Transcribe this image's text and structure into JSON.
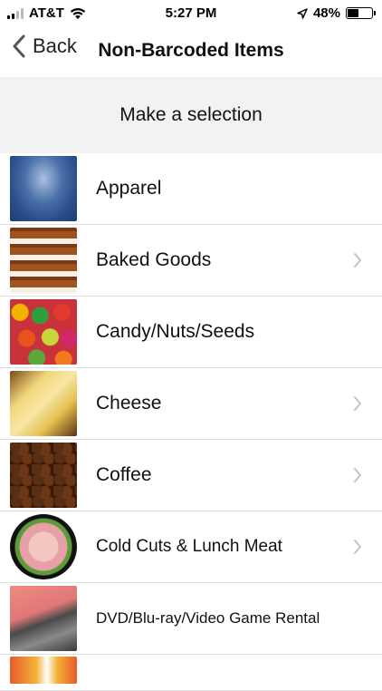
{
  "status_bar": {
    "carrier": "AT&T",
    "time": "5:27 PM",
    "battery_percent": "48%",
    "battery_level": 0.48,
    "icons": [
      "signal-icon",
      "wifi-icon",
      "location-arrow-icon",
      "battery-icon"
    ]
  },
  "nav": {
    "back_label": "Back",
    "title": "Non-Barcoded Items"
  },
  "section_header": "Make a selection",
  "items": [
    {
      "label": "Apparel",
      "has_chevron": false
    },
    {
      "label": "Baked Goods",
      "has_chevron": true
    },
    {
      "label": "Candy/Nuts/Seeds",
      "has_chevron": false
    },
    {
      "label": "Cheese",
      "has_chevron": true
    },
    {
      "label": "Coffee",
      "has_chevron": true
    },
    {
      "label": "Cold Cuts & Lunch Meat",
      "has_chevron": true
    },
    {
      "label": "DVD/Blu-ray/Video Game Rental",
      "has_chevron": false
    }
  ],
  "colors": {
    "section_bg": "#f2f2f2",
    "divider": "#dedede",
    "chevron": "#c4c4c6"
  }
}
